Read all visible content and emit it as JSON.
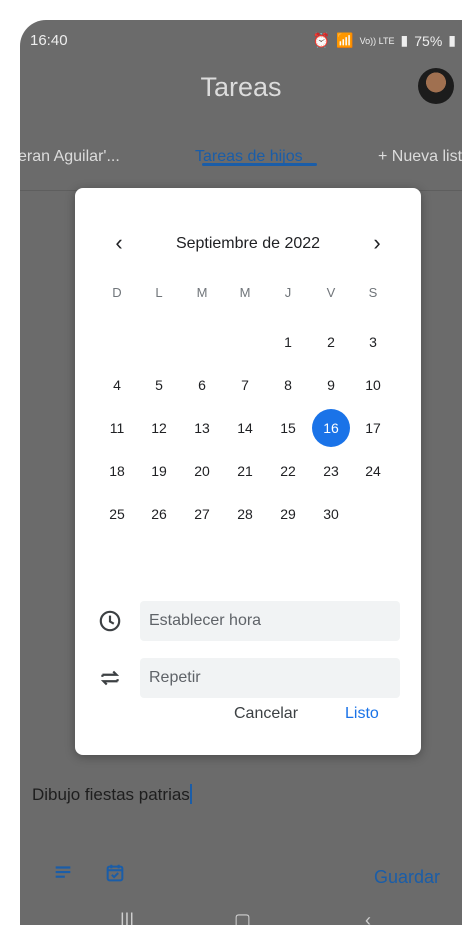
{
  "status_bar": {
    "time": "16:40",
    "network": "Vo)) LTE",
    "battery": "75%"
  },
  "app": {
    "title": "Tareas"
  },
  "tabs": [
    {
      "label": "Teran Aguilar'..."
    },
    {
      "label": "Tareas de hijos"
    },
    {
      "label": "+  Nueva lista"
    }
  ],
  "calendar": {
    "month_label": "Septiembre de 2022",
    "prev_icon": "‹",
    "next_icon": "›",
    "weekdays": [
      "D",
      "L",
      "M",
      "M",
      "J",
      "V",
      "S"
    ],
    "weeks": [
      [
        "",
        "",
        "",
        "",
        "1",
        "2",
        "3"
      ],
      [
        "4",
        "5",
        "6",
        "7",
        "8",
        "9",
        "10"
      ],
      [
        "11",
        "12",
        "13",
        "14",
        "15",
        "16",
        "17"
      ],
      [
        "18",
        "19",
        "20",
        "21",
        "22",
        "23",
        "24"
      ],
      [
        "25",
        "26",
        "27",
        "28",
        "29",
        "30",
        ""
      ]
    ],
    "selected_day": "16",
    "time_field": "Establecer hora",
    "repeat_field": "Repetir",
    "cancel_label": "Cancelar",
    "done_label": "Listo"
  },
  "task": {
    "title": "Dibujo fiestas patrias",
    "save_label": "Guardar"
  },
  "colors": {
    "accent": "#1a73e8",
    "dim_accent": "#1a5da8",
    "scrim": "#6b6b6b"
  }
}
